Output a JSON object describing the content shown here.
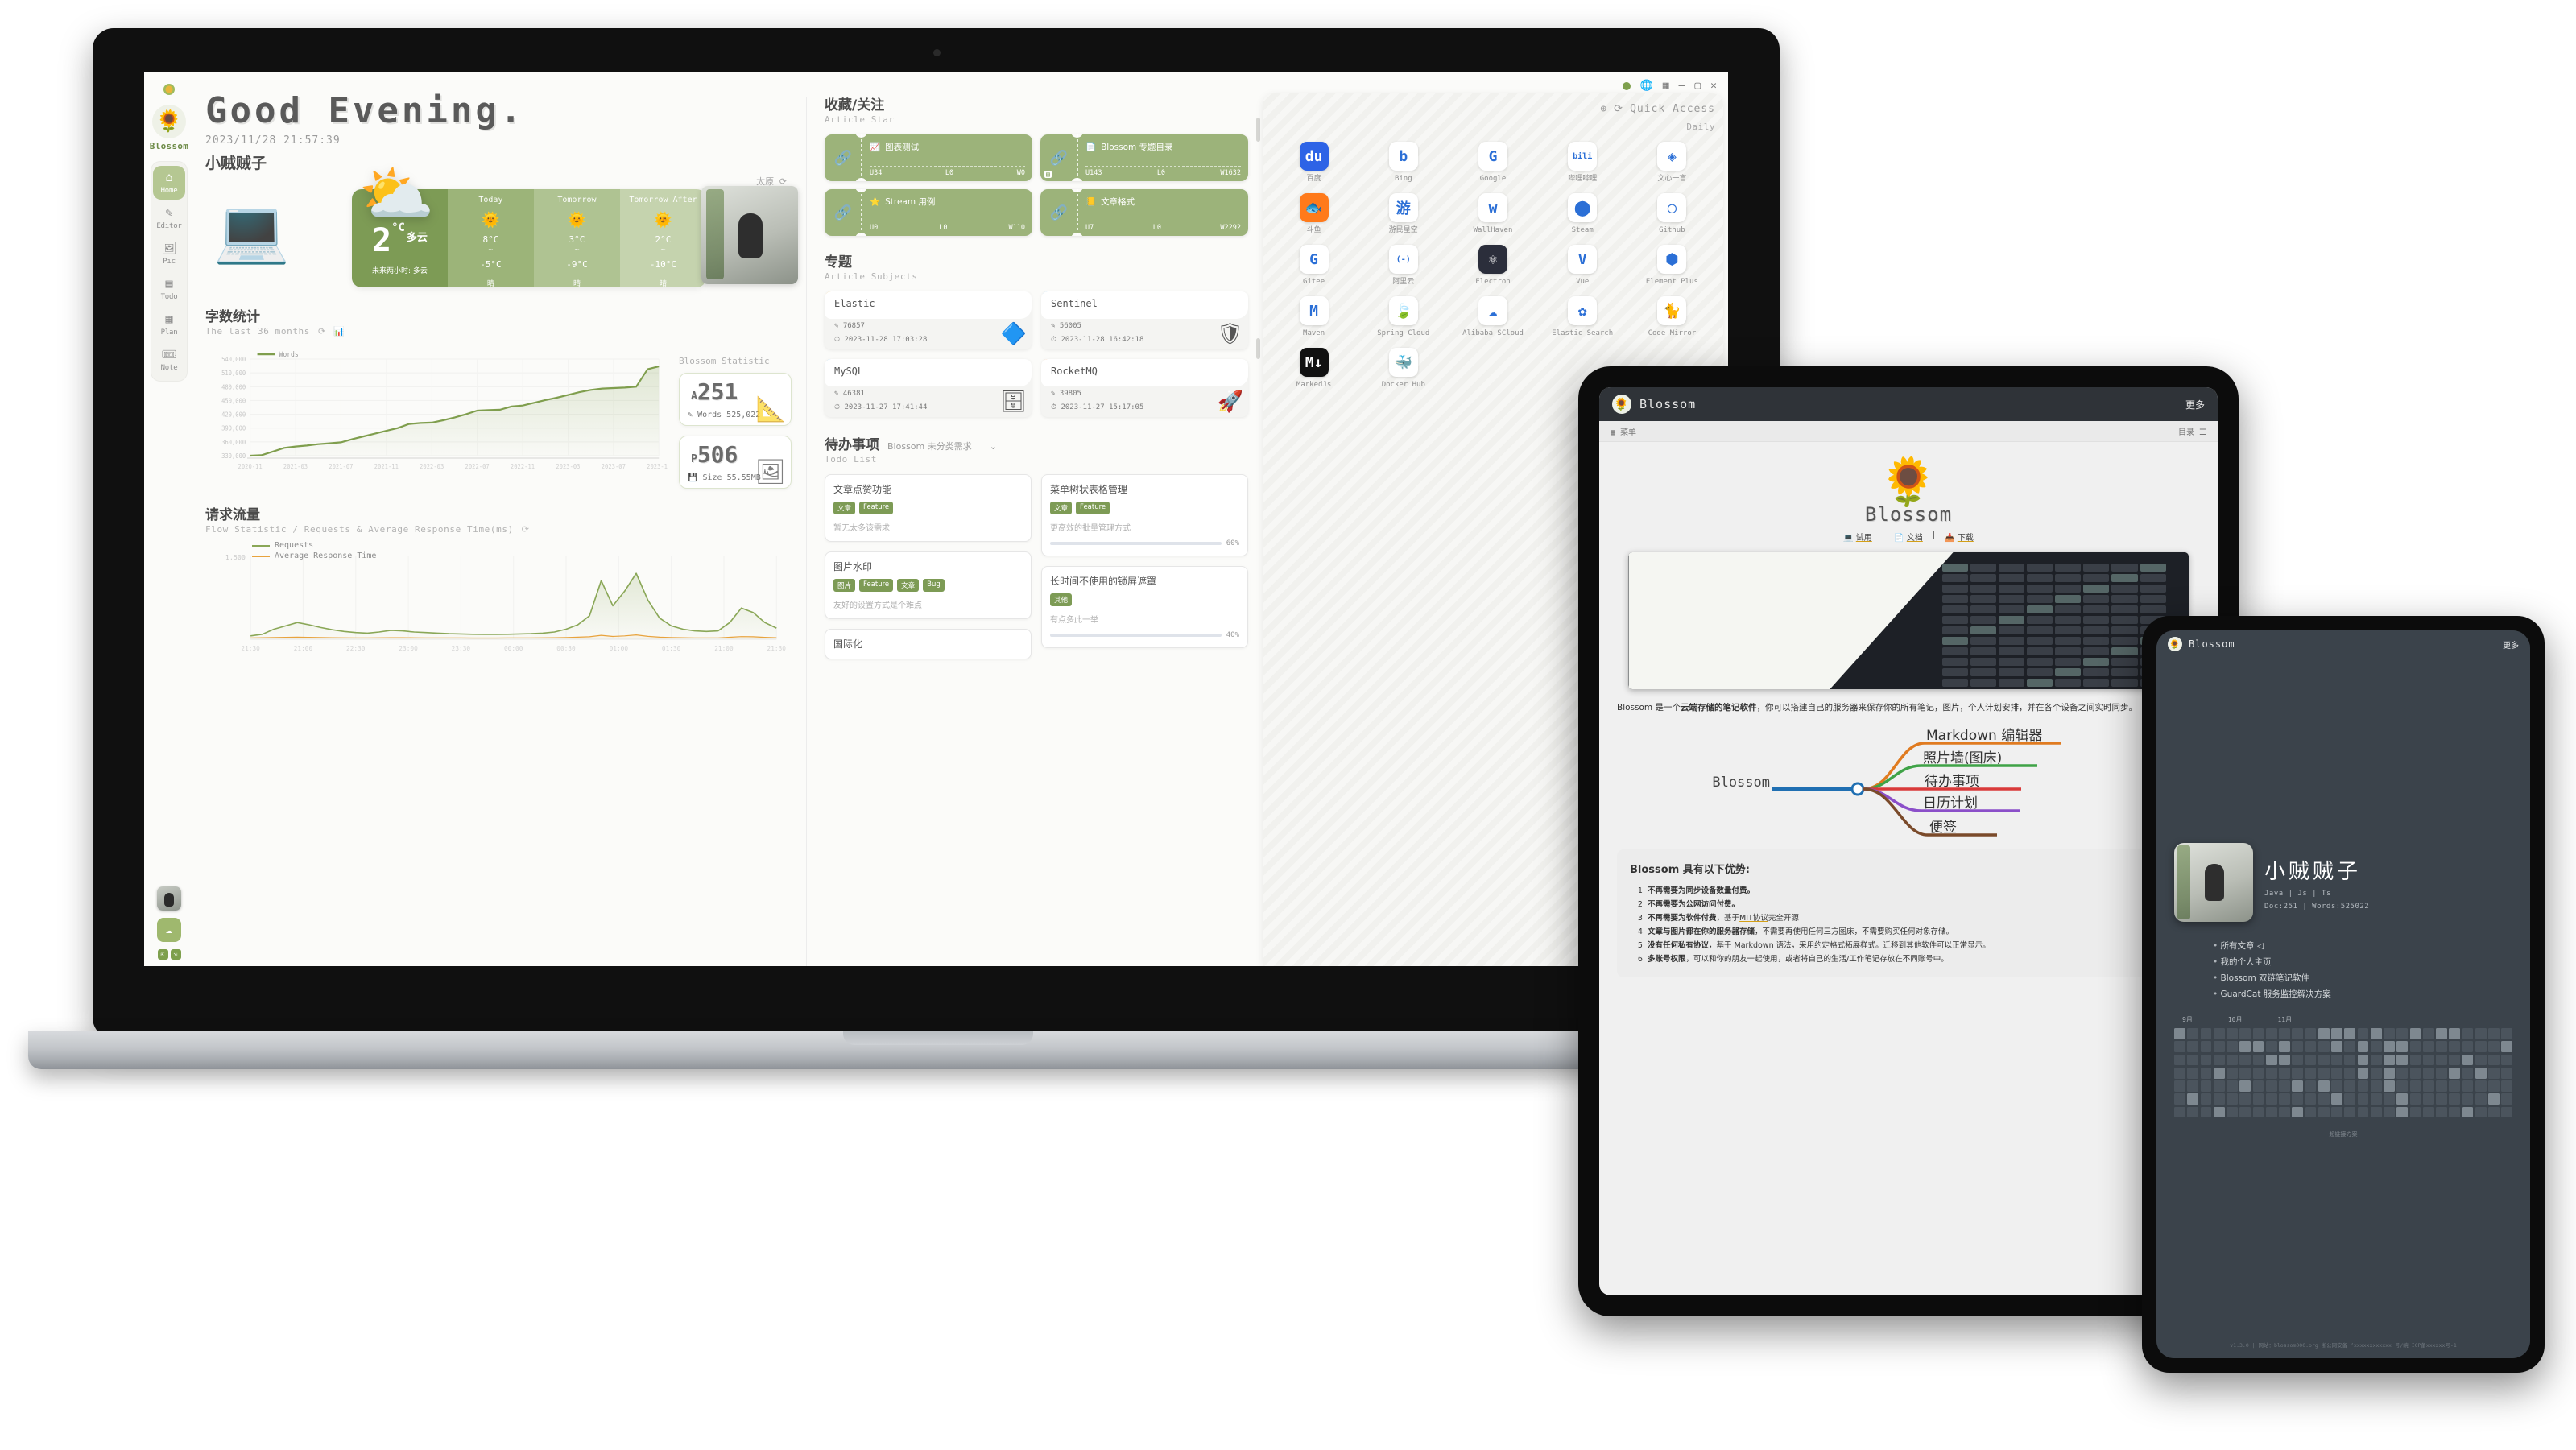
{
  "laptop": {
    "window_controls": [
      "sync-dot",
      "globe-icon",
      "grid-icon",
      "minimize",
      "maximize",
      "close"
    ],
    "sidebar": {
      "brand": "Blossom",
      "items": [
        {
          "label": "Home",
          "icon": "home-icon",
          "active": true
        },
        {
          "label": "Editor",
          "icon": "pen-icon",
          "active": false
        },
        {
          "label": "Pic",
          "icon": "picture-icon",
          "active": false
        },
        {
          "label": "Todo",
          "icon": "bookmark-list-icon",
          "active": false
        },
        {
          "label": "Plan",
          "icon": "calendar-icon",
          "active": false
        },
        {
          "label": "Note",
          "icon": "ticket-icon",
          "active": false
        }
      ]
    },
    "header": {
      "greeting": "Good Evening.",
      "datetime": "2023/11/28 21:57:39",
      "username": "小贼贼子"
    },
    "weather": {
      "city": "太原",
      "current": {
        "temp": "2",
        "unit": "°C",
        "desc": "多云",
        "next": "未来两小时: 多云",
        "emoji": "⛅"
      },
      "forecast": [
        {
          "day": "Today",
          "emoji": "☀",
          "high": "8°C",
          "sep": "~",
          "low": "-5°C",
          "desc": "晴"
        },
        {
          "day": "Tomorrow",
          "emoji": "☀",
          "high": "3°C",
          "sep": "~",
          "low": "-9°C",
          "desc": "晴"
        },
        {
          "day": "Tomorrow After",
          "emoji": "☀",
          "high": "2°C",
          "sep": "~",
          "low": "-10°C",
          "desc": "晴"
        }
      ]
    },
    "words_section": {
      "title": "字数统计",
      "subtitle": "The last 36 months",
      "icons": [
        "refresh-icon",
        "chart-icon"
      ],
      "stat_title": "Blossom Statistic",
      "cards": [
        {
          "prefix": "A",
          "value": "251",
          "sub": "Words 525,022",
          "sub_icon": "pen-icon",
          "icon": "ruler-icon"
        },
        {
          "prefix": "P",
          "value": "506",
          "sub": "Size 55.55MB",
          "sub_icon": "disk-icon",
          "icon": "picture-icon"
        }
      ]
    },
    "flow_section": {
      "title": "请求流量",
      "subtitle": "Flow Statistic / Requests & Average Response Time(ms)",
      "icons": [
        "refresh-icon"
      ],
      "legend": [
        {
          "name": "Requests",
          "color": "#8aa757"
        },
        {
          "name": "Average Response Time",
          "color": "#e8a33d"
        }
      ]
    },
    "star_section": {
      "title": "收藏/关注",
      "subtitle": "Article Star",
      "items": [
        {
          "emoji": "📈",
          "name": "图表测试",
          "u": "U34",
          "l": "L0",
          "w": "W0",
          "badge": false
        },
        {
          "emoji": "📄",
          "name": "Blossom 专题目录",
          "u": "U143",
          "l": "L0",
          "w": "W1632",
          "badge": true
        },
        {
          "emoji": "⭐",
          "name": "Stream 用例",
          "u": "U0",
          "l": "L0",
          "w": "W110",
          "badge": false
        },
        {
          "emoji": "📒",
          "name": "文章格式",
          "u": "U7",
          "l": "L0",
          "w": "W2292",
          "badge": false
        }
      ]
    },
    "subjects_section": {
      "title": "专题",
      "subtitle": "Article Subjects",
      "items": [
        {
          "name": "Elastic",
          "views": "76857",
          "time": "2023-11-28 17:03:28",
          "bar": "#f2d38a",
          "logo": "🔷"
        },
        {
          "name": "Sentinel",
          "views": "56005",
          "time": "2023-11-28 16:42:18",
          "bar": "#a6d4f2",
          "logo": "🛡"
        },
        {
          "name": "MySQL",
          "views": "46381",
          "time": "2023-11-27 17:41:44",
          "bar": "#a6d4f2",
          "logo": "🗄"
        },
        {
          "name": "RocketMQ",
          "views": "39805",
          "time": "2023-11-27 15:17:05",
          "bar": "#f0b183",
          "logo": "🚀"
        }
      ]
    },
    "todo_section": {
      "title": "待办事项",
      "subtitle": "Todo List",
      "filter": "Blossom 未分类需求",
      "filter_icon": "chevron-down-icon",
      "left_items": [
        {
          "title": "文章点赞功能",
          "tags": [
            "文章",
            "Feature"
          ],
          "desc": "暂无太多该需求"
        },
        {
          "title": "图片水印",
          "tags": [
            "图片",
            "Feature",
            "文章",
            "Bug"
          ],
          "desc": "友好的设置方式是个难点"
        },
        {
          "title": "国际化",
          "tags": [],
          "desc": ""
        }
      ],
      "right_items": [
        {
          "title": "菜单树状表格管理",
          "tags": [
            "文章",
            "Feature"
          ],
          "desc": "更高效的批量管理方式",
          "progress": 60,
          "pct": "60%",
          "color": "#c2d14f"
        },
        {
          "title": "长时间不使用的锁屏遮罩",
          "tags": [
            "其他"
          ],
          "desc": "有点多此一举",
          "progress": 40,
          "pct": "40%",
          "color": "#6f8bbd"
        }
      ]
    },
    "quick_access": {
      "title": "Quick Access",
      "icons": [
        "plus-icon",
        "refresh-icon"
      ],
      "group_label": "Daily",
      "items": [
        {
          "label": "百度",
          "icon": "baidu-icon",
          "bg": "#2d63e6",
          "glyph": "du"
        },
        {
          "label": "Bing",
          "icon": "bing-icon",
          "bg": "#ffffff",
          "glyph": "b"
        },
        {
          "label": "Google",
          "icon": "google-icon",
          "bg": "#ffffff",
          "glyph": "G"
        },
        {
          "label": "哔哩哔哩",
          "icon": "bilibili-icon",
          "bg": "#ffffff",
          "glyph": "bili"
        },
        {
          "label": "文心一言",
          "icon": "wenxin-icon",
          "bg": "#ffffff",
          "glyph": "◈"
        },
        {
          "label": "斗鱼",
          "icon": "douyu-icon",
          "bg": "#ff7a1a",
          "glyph": "🐟"
        },
        {
          "label": "游民星空",
          "icon": "gamersky-icon",
          "bg": "#ffffff",
          "glyph": "游"
        },
        {
          "label": "WallHaven",
          "icon": "wallhaven-icon",
          "bg": "#ffffff",
          "glyph": "w"
        },
        {
          "label": "Steam",
          "icon": "steam-icon",
          "bg": "#ffffff",
          "glyph": "⬤"
        },
        {
          "label": "Github",
          "icon": "github-icon",
          "bg": "#ffffff",
          "glyph": "◯"
        },
        {
          "label": "Gitee",
          "icon": "gitee-icon",
          "bg": "#ffffff",
          "glyph": "G"
        },
        {
          "label": "阿里云",
          "icon": "aliyun-icon",
          "bg": "#ffffff",
          "glyph": "(-)"
        },
        {
          "label": "Electron",
          "icon": "electron-icon",
          "bg": "#2b2e3b",
          "glyph": "⚛"
        },
        {
          "label": "Vue",
          "icon": "vue-icon",
          "bg": "#ffffff",
          "glyph": "V"
        },
        {
          "label": "Element Plus",
          "icon": "element-plus-icon",
          "bg": "#ffffff",
          "glyph": "⬢"
        },
        {
          "label": "Maven",
          "icon": "maven-icon",
          "bg": "#ffffff",
          "glyph": "M"
        },
        {
          "label": "Spring Cloud",
          "icon": "spring-icon",
          "bg": "#ffffff",
          "glyph": "🍃"
        },
        {
          "label": "Alibaba SCloud",
          "icon": "alibaba-scloud-icon",
          "bg": "#ffffff",
          "glyph": "☁"
        },
        {
          "label": "Elastic Search",
          "icon": "elasticsearch-icon",
          "bg": "#ffffff",
          "glyph": "✿"
        },
        {
          "label": "Code Mirror",
          "icon": "codemirror-icon",
          "bg": "#ffffff",
          "glyph": "🐈"
        },
        {
          "label": "MarkedJs",
          "icon": "markedjs-icon",
          "bg": "#111111",
          "glyph": "M↓"
        },
        {
          "label": "Docker Hub",
          "icon": "docker-icon",
          "bg": "#ffffff",
          "glyph": "🐳"
        }
      ]
    }
  },
  "tablet": {
    "titlebar": {
      "brand": "Blossom",
      "more": "更多",
      "flower": "🌻"
    },
    "subbar": {
      "menu": "菜单",
      "menu_icon": "grid-icon",
      "right_label": "目录",
      "right_icon": "list-icon"
    },
    "hero": {
      "name": "Blossom",
      "flower": "🌻",
      "links": [
        {
          "label": "试用",
          "icon": "laptop-icon"
        },
        {
          "label": "文档",
          "icon": "doc-icon"
        },
        {
          "label": "下载",
          "icon": "download-icon"
        }
      ]
    },
    "paragraph": "Blossom 是一个云端存储的笔记软件，你可以搭建自己的服务器来保存你的所有笔记，图片，个人计划安排，并在各个设备之间实时同步。",
    "paragraph_bold": "云端存储的笔记软件",
    "mindmap": {
      "root": "Blossom",
      "branches": [
        {
          "label": "Markdown 编辑器",
          "color": "#e07b20"
        },
        {
          "label": "照片墙(图床)",
          "color": "#3fa347"
        },
        {
          "label": "待办事项",
          "color": "#d93a3a"
        },
        {
          "label": "日历计划",
          "color": "#8b4fc9"
        },
        {
          "label": "便签",
          "color": "#7a4a2a"
        }
      ]
    },
    "advantages": {
      "title": "Blossom 具有以下优势:",
      "items": [
        {
          "bold": "不再需要为同步设备数量付费。",
          "rest": ""
        },
        {
          "bold": "不再需要为公网访问付费。",
          "rest": ""
        },
        {
          "bold": "不再需要为软件付费",
          "rest": "，基于MIT协议完全开源",
          "link": "MIT协议"
        },
        {
          "bold": "文章与图片都在你的服务器存储",
          "rest": "，不需要再使用任何三方图床，不需要购买任何对象存储。"
        },
        {
          "bold": "没有任何私有协议",
          "rest": "，基于 Markdown 语法，采用约定格式拓展样式。迁移到其他软件可以正常显示。"
        },
        {
          "bold": "多账号权限",
          "rest": "，可以和你的朋友一起使用，或者将自己的生活/工作笔记存放在不同账号中。"
        }
      ]
    }
  },
  "phone": {
    "titlebar": {
      "brand": "Blossom",
      "more": "更多",
      "flower": "🌻"
    },
    "profile": {
      "name": "小贼贼子",
      "skills": "Java | Js | Ts",
      "stats": "Doc:251 | Words:525022"
    },
    "links": [
      "所有文章 ◁",
      "我的个人主页",
      "Blossom 双链笔记软件",
      "GuardCat 服务监控解决方案"
    ],
    "calendar": {
      "months": [
        "9月",
        "10月",
        "11月"
      ],
      "footer": "超链接方案"
    },
    "footer": "v1.3.0 | 网站：blossom000.org\n浙公网安备 ‘xxxxxxxxxxxx 号/皖 ICP备xxxxxx号-1"
  },
  "chart_data": [
    {
      "type": "area",
      "id": "words-chart",
      "title": "字数统计",
      "subtitle": "The last 36 months",
      "xlabel": "",
      "ylabel": "Words",
      "legend": [
        "Words"
      ],
      "legend_position": "top-left",
      "grid": true,
      "ylim": [
        330000,
        540000
      ],
      "yticks": [
        330000,
        360000,
        390000,
        420000,
        450000,
        480000,
        510000,
        540000
      ],
      "ytick_labels": [
        "330,000",
        "360,000",
        "390,000",
        "420,000",
        "450,000",
        "480,000",
        "510,000",
        "540,000"
      ],
      "xtick_labels": [
        "2020-11",
        "2021-03",
        "2021-07",
        "2021-11",
        "2022-03",
        "2022-07",
        "2022-11",
        "2023-03",
        "2023-07",
        "2023-11"
      ],
      "x": [
        "2020-11",
        "2020-12",
        "2021-01",
        "2021-02",
        "2021-03",
        "2021-04",
        "2021-05",
        "2021-06",
        "2021-07",
        "2021-08",
        "2021-09",
        "2021-10",
        "2021-11",
        "2021-12",
        "2022-01",
        "2022-02",
        "2022-03",
        "2022-04",
        "2022-05",
        "2022-06",
        "2022-07",
        "2022-08",
        "2022-09",
        "2022-10",
        "2022-11",
        "2022-12",
        "2023-01",
        "2023-02",
        "2023-03",
        "2023-04",
        "2023-05",
        "2023-06",
        "2023-07",
        "2023-08",
        "2023-09",
        "2023-10",
        "2023-11"
      ],
      "values": [
        330000,
        331000,
        339000,
        347000,
        350000,
        352000,
        355000,
        357000,
        359000,
        366000,
        372000,
        378000,
        384000,
        390000,
        399000,
        401000,
        402000,
        407000,
        413000,
        420000,
        428000,
        429000,
        430000,
        437000,
        439000,
        445000,
        451000,
        456000,
        462000,
        468000,
        473000,
        476000,
        477000,
        478000,
        480000,
        518000,
        524000
      ],
      "series": [
        {
          "name": "Words",
          "color": "#7f9e4d",
          "values": [
            330000,
            331000,
            339000,
            347000,
            350000,
            352000,
            355000,
            357000,
            359000,
            366000,
            372000,
            378000,
            384000,
            390000,
            399000,
            401000,
            402000,
            407000,
            413000,
            420000,
            428000,
            429000,
            430000,
            437000,
            439000,
            445000,
            451000,
            456000,
            462000,
            468000,
            473000,
            476000,
            477000,
            478000,
            480000,
            518000,
            524000
          ]
        }
      ]
    },
    {
      "type": "area",
      "id": "flow-chart",
      "title": "请求流量",
      "subtitle": "Flow Statistic / Requests & Average Response Time(ms)",
      "grid": true,
      "ylim": [
        0,
        1500
      ],
      "yticks": [
        0,
        1500
      ],
      "ytick_labels": [
        "1,500"
      ],
      "xtick_labels": [
        "21:30",
        "21:00",
        "22:30",
        "23:00",
        "23:30",
        "00:00",
        "00:30",
        "01:00",
        "01:30",
        "21:00",
        "21:30"
      ],
      "legend": [
        "Requests",
        "Average Response Time"
      ],
      "legend_position": "top-left",
      "series": [
        {
          "name": "Requests",
          "color": "#8aa757",
          "values": [
            60,
            90,
            180,
            240,
            300,
            260,
            210,
            170,
            140,
            120,
            110,
            130,
            160,
            150,
            130,
            120,
            110,
            100,
            95,
            90,
            88,
            86,
            90,
            95,
            100,
            110,
            130,
            180,
            260,
            420,
            1050,
            600,
            860,
            1180,
            700,
            380,
            240,
            180,
            150,
            140,
            150,
            300,
            560,
            480,
            300,
            200
          ]
        },
        {
          "name": "Average Response Time",
          "color": "#e8a33d",
          "values": [
            25,
            28,
            30,
            35,
            38,
            34,
            30,
            28,
            26,
            25,
            24,
            26,
            28,
            27,
            26,
            25,
            24,
            23,
            23,
            22,
            22,
            22,
            23,
            24,
            25,
            26,
            28,
            32,
            38,
            45,
            70,
            50,
            60,
            78,
            52,
            38,
            30,
            27,
            25,
            24,
            25,
            36,
            48,
            44,
            34,
            28
          ]
        }
      ]
    }
  ]
}
